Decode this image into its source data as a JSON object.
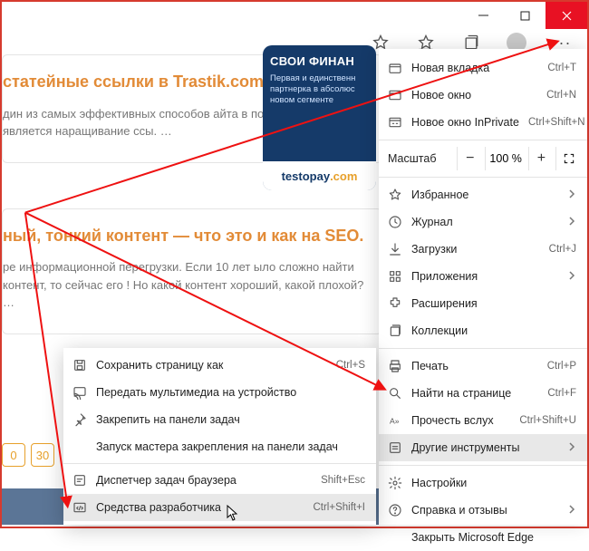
{
  "window": {
    "minimize_icon": "minimize-icon",
    "maximize_icon": "maximize-icon",
    "close_icon": "close-icon"
  },
  "urlbar": {
    "star_icon": "star-icon",
    "favorites_icon": "favorites-bar-icon",
    "collections_icon": "collections-icon",
    "profile_icon": "profile-avatar",
    "more_icon": "more-icon",
    "more_label": "···"
  },
  "page": {
    "card1": {
      "title": "статейные ссылки в Trastik.com",
      "body": "дин из самых эффективных способов айта в поисковых система является наращивание ссы. …"
    },
    "card2": {
      "title": "ный, тонкий контент — что это и как на SEO.",
      "body": "ре информационной перегрузки. Если 10 лет ыло сложно найти контент, то сейчас его ! Но какой контент хороший, какой плохой? …"
    },
    "promo": {
      "top": "СВОИ ФИНАН",
      "mid": "Первая и единственн партнерка в абсолюс новом сегменте",
      "brand_a": "testopay",
      "brand_b": ".com"
    },
    "pagination": [
      "0",
      "30"
    ]
  },
  "main_menu": {
    "zoom_label": "Масштаб",
    "zoom_value": "100 %",
    "items": [
      {
        "icon": "tab-icon",
        "label": "Новая вкладка",
        "shortcut": "Ctrl+T",
        "chev": false
      },
      {
        "icon": "window-icon",
        "label": "Новое окно",
        "shortcut": "Ctrl+N",
        "chev": false
      },
      {
        "icon": "inprivate-icon",
        "label": "Новое окно InPrivate",
        "shortcut": "Ctrl+Shift+N",
        "chev": false
      },
      {
        "divider": true
      },
      {
        "zoom": true
      },
      {
        "divider": true
      },
      {
        "icon": "star-icon",
        "label": "Избранное",
        "shortcut": "",
        "chev": true
      },
      {
        "icon": "history-icon",
        "label": "Журнал",
        "shortcut": "",
        "chev": true
      },
      {
        "icon": "download-icon",
        "label": "Загрузки",
        "shortcut": "Ctrl+J",
        "chev": false
      },
      {
        "icon": "apps-icon",
        "label": "Приложения",
        "shortcut": "",
        "chev": true
      },
      {
        "icon": "extensions-icon",
        "label": "Расширения",
        "shortcut": "",
        "chev": false
      },
      {
        "icon": "collections-icon",
        "label": "Коллекции",
        "shortcut": "",
        "chev": false
      },
      {
        "divider": true
      },
      {
        "icon": "print-icon",
        "label": "Печать",
        "shortcut": "Ctrl+P",
        "chev": false
      },
      {
        "icon": "find-icon",
        "label": "Найти на странице",
        "shortcut": "Ctrl+F",
        "chev": false
      },
      {
        "icon": "readaloud-icon",
        "label": "Прочесть вслух",
        "shortcut": "Ctrl+Shift+U",
        "chev": false
      },
      {
        "icon": "tools-icon",
        "label": "Другие инструменты",
        "shortcut": "",
        "chev": true,
        "hover": true
      },
      {
        "divider": true
      },
      {
        "icon": "settings-icon",
        "label": "Настройки",
        "shortcut": "",
        "chev": false
      },
      {
        "icon": "help-icon",
        "label": "Справка и отзывы",
        "shortcut": "",
        "chev": true
      },
      {
        "icon": "",
        "label": "Закрыть Microsoft Edge",
        "shortcut": "",
        "chev": false
      }
    ]
  },
  "sub_menu": {
    "items": [
      {
        "icon": "save-icon",
        "label": "Сохранить страницу как",
        "shortcut": "Ctrl+S"
      },
      {
        "icon": "cast-icon",
        "label": "Передать мультимедиа на устройство",
        "shortcut": ""
      },
      {
        "icon": "pin-icon",
        "label": "Закрепить на панели задач",
        "shortcut": ""
      },
      {
        "icon": "",
        "label": "Запуск мастера закрепления на панели задач",
        "shortcut": ""
      },
      {
        "divider": true
      },
      {
        "icon": "task-icon",
        "label": "Диспетчер задач браузера",
        "shortcut": "Shift+Esc"
      },
      {
        "icon": "devtools-icon",
        "label": "Средства разработчика",
        "shortcut": "Ctrl+Shift+I",
        "hover": true
      }
    ]
  }
}
